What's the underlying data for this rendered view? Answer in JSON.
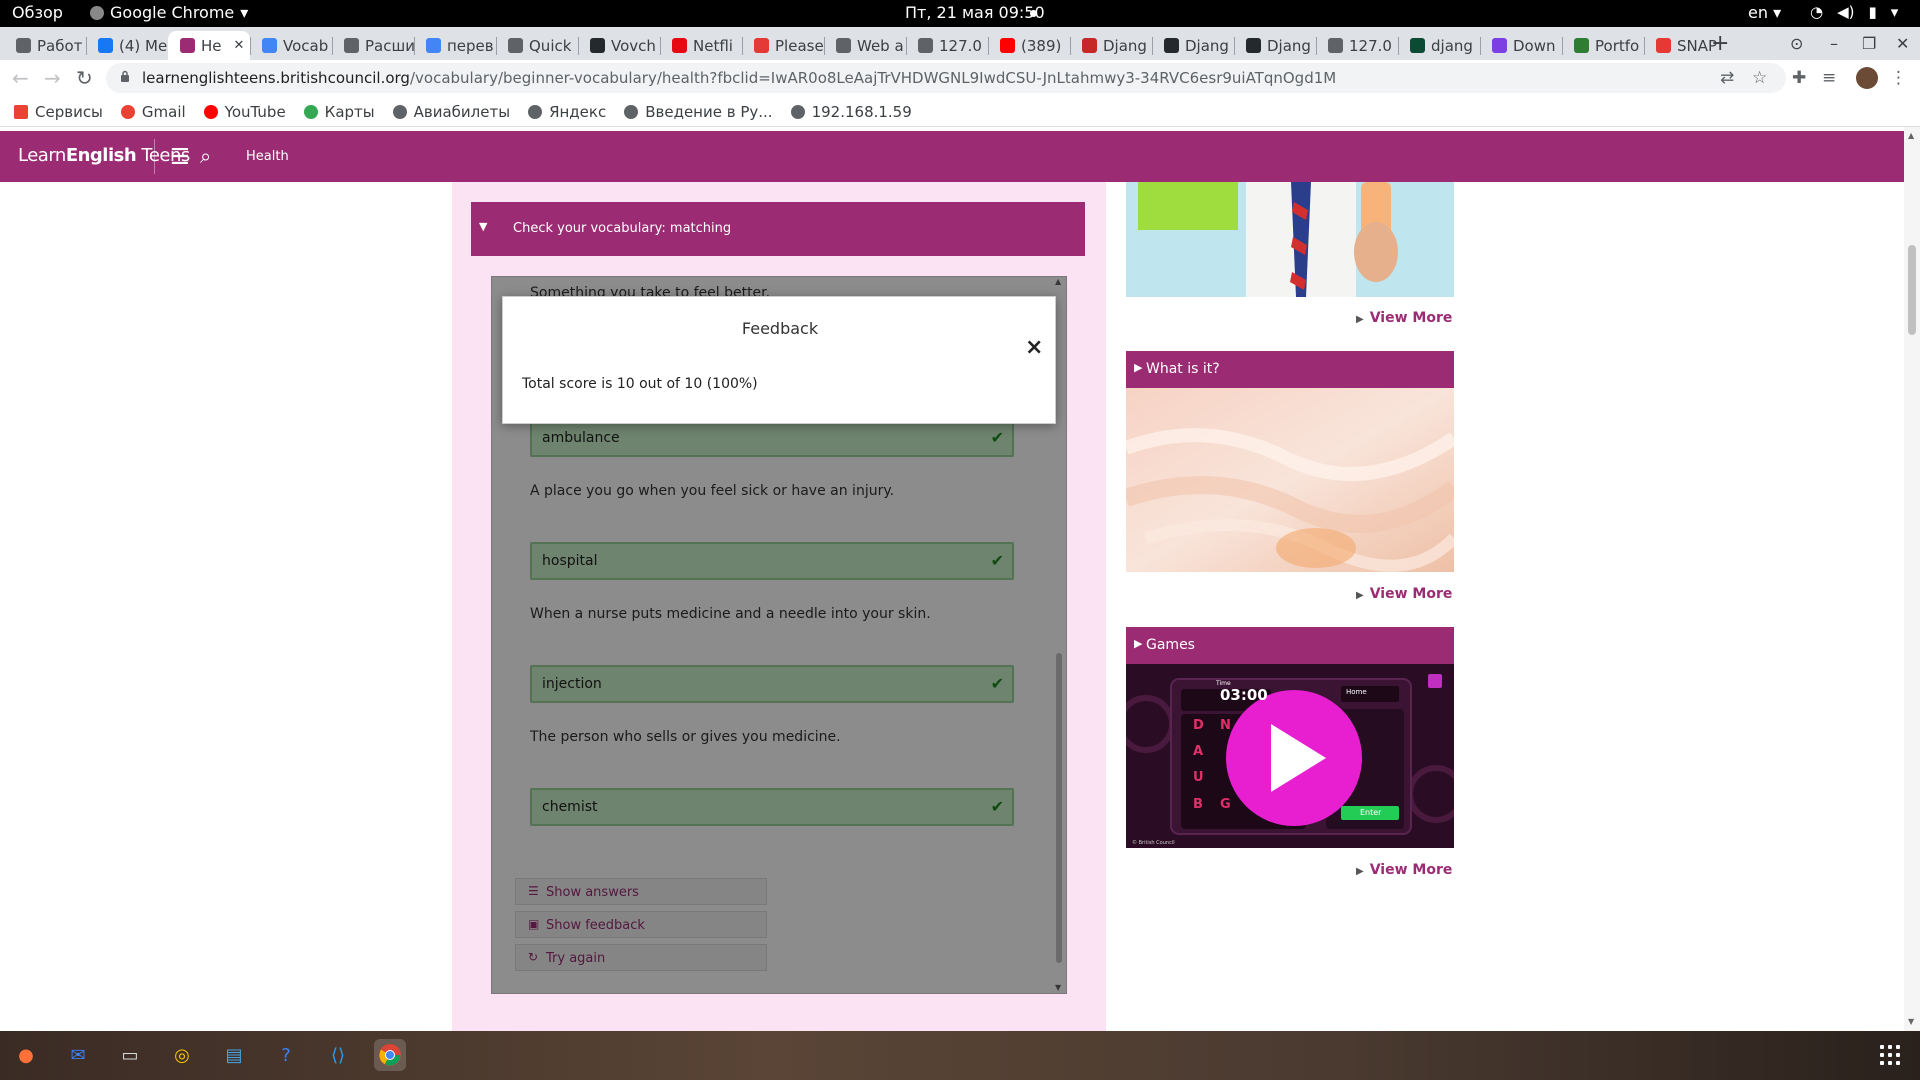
{
  "desktop": {
    "overview": "Обзор",
    "active_app": "Google Chrome",
    "clock": "Пт, 21 мая  09:50",
    "lang": "en"
  },
  "tabs": [
    {
      "label": "Работ",
      "color": "#5f6368"
    },
    {
      "label": "(4) Me",
      "color": "#1877f2"
    },
    {
      "label": "He",
      "color": "#9b2c74",
      "active": true
    },
    {
      "label": "Vocab",
      "color": "#4285f4"
    },
    {
      "label": "Расши",
      "color": "#5f6368"
    },
    {
      "label": "перев",
      "color": "#4285f4"
    },
    {
      "label": "Quick",
      "color": "#5f6368"
    },
    {
      "label": "Vovch",
      "color": "#24292e"
    },
    {
      "label": "Netfli",
      "color": "#e50914"
    },
    {
      "label": "Please",
      "color": "#e53935"
    },
    {
      "label": "Web a",
      "color": "#5f6368"
    },
    {
      "label": "127.0",
      "color": "#5f6368"
    },
    {
      "label": "(389)",
      "color": "#ff0000"
    },
    {
      "label": "Djang",
      "color": "#c62828"
    },
    {
      "label": "Djang",
      "color": "#24292e"
    },
    {
      "label": "Djang",
      "color": "#24292e"
    },
    {
      "label": "127.0",
      "color": "#5f6368"
    },
    {
      "label": "djang",
      "color": "#0c4b33"
    },
    {
      "label": "Down",
      "color": "#7b3fe4"
    },
    {
      "label": "Portfo",
      "color": "#2e7d32"
    },
    {
      "label": "SNAP",
      "color": "#e53935"
    }
  ],
  "url": {
    "host": "learnenglishteens.britishcouncil.org",
    "path": "/vocabulary/beginner-vocabulary/health?fbclid=IwAR0o8LeAajTrVHDWGNL9IwdCSU-JnLtahmwy3-34RVC6esr9uiATqnOgd1M"
  },
  "bookmarks": [
    {
      "label": "Сервисы",
      "color": "#ea4335"
    },
    {
      "label": "Gmail",
      "color": "#ea4335"
    },
    {
      "label": "YouTube",
      "color": "#ff0000"
    },
    {
      "label": "Карты",
      "color": "#34a853"
    },
    {
      "label": "Авиабилеты",
      "color": "#5f6368"
    },
    {
      "label": "Яндекс",
      "color": "#5f6368"
    },
    {
      "label": "Введение в Ру...",
      "color": "#5f6368"
    },
    {
      "label": "192.168.1.59",
      "color": "#5f6368"
    }
  ],
  "site": {
    "logo_light": "Learn",
    "logo_bold": "English",
    "logo_tail": " Teens",
    "breadcrumb": "Health",
    "accent": "#9b2c74"
  },
  "exercise": {
    "section_title": "Check your vocabulary: matching",
    "partial_question": "Something you take to feel better.",
    "items": [
      {
        "question": "",
        "answer": "ambulance"
      },
      {
        "question": "A place you go when you feel sick or have an injury.",
        "answer": "hospital"
      },
      {
        "question": "When a nurse puts medicine and a needle into your skin.",
        "answer": "injection"
      },
      {
        "question": "The person who sells or gives you medicine.",
        "answer": "chemist"
      }
    ],
    "buttons": {
      "show_answers": "Show answers",
      "show_feedback": "Show feedback",
      "try_again": "Try again"
    }
  },
  "feedback_modal": {
    "title": "Feedback",
    "close": "×",
    "score_text": "Total score is 10 out of 10 (100%)"
  },
  "sidebar": {
    "view_more": "View More",
    "sections": [
      {
        "title": "What is it?"
      },
      {
        "title": "Games"
      }
    ],
    "game": {
      "timer_label": "Time",
      "timer": "03:00",
      "home": "Home",
      "enter": "Enter",
      "letters": [
        "D",
        "N",
        "A",
        "U",
        "B",
        "G"
      ],
      "credit": "© British Council"
    }
  }
}
